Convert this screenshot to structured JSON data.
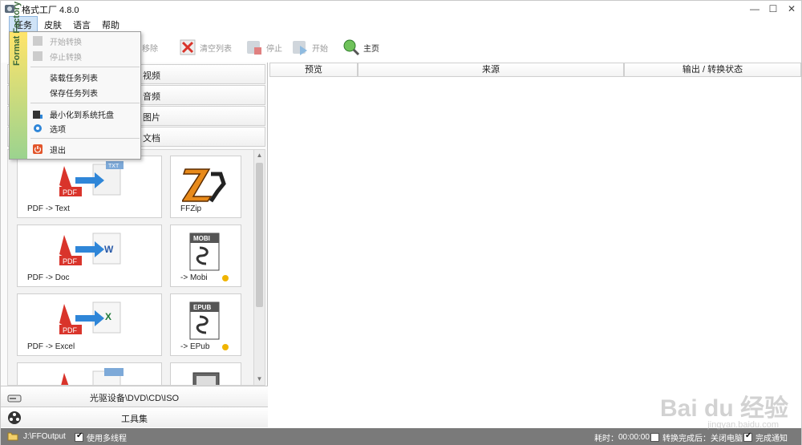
{
  "window": {
    "title": "格式工厂 4.8.0",
    "controls": {
      "minimize": "—",
      "maximize": "☐",
      "close": "✕"
    }
  },
  "menubar": {
    "items": [
      {
        "label": "任务",
        "open": true
      },
      {
        "label": "皮肤"
      },
      {
        "label": "语言"
      },
      {
        "label": "帮助"
      }
    ]
  },
  "toolbar": {
    "remove": "移除",
    "clear": "清空列表",
    "stop": "停止",
    "start": "开始",
    "home": "主页"
  },
  "dropdown": {
    "side_text": "Format Factory",
    "items": [
      {
        "label": "开始转换",
        "enabled": false,
        "icon": "gear-icon"
      },
      {
        "label": "停止转换",
        "enabled": false,
        "icon": "stop-icon"
      },
      {
        "label": "装载任务列表",
        "enabled": true,
        "icon": ""
      },
      {
        "label": "保存任务列表",
        "enabled": true,
        "icon": ""
      },
      {
        "label": "最小化到系统托盘",
        "enabled": true,
        "icon": "tray-icon"
      },
      {
        "label": "选项",
        "enabled": true,
        "icon": "options-icon"
      },
      {
        "label": "退出",
        "enabled": true,
        "icon": "power-icon"
      }
    ]
  },
  "leftpanel": {
    "categories": [
      "视频",
      "音频",
      "图片",
      "文档"
    ],
    "tiles": [
      {
        "label": "PDF -> Text",
        "icon": "pdf-to-text-icon",
        "dot": false
      },
      {
        "label": "FFZip",
        "icon": "ffzip-icon",
        "dot": false
      },
      {
        "label": "PDF -> Doc",
        "icon": "pdf-to-doc-icon",
        "dot": false
      },
      {
        "label": "-> Mobi",
        "icon": "mobi-icon",
        "dot": true
      },
      {
        "label": "PDF -> Excel",
        "icon": "pdf-to-excel-icon",
        "dot": false
      },
      {
        "label": "-> EPub",
        "icon": "epub-icon",
        "dot": true
      }
    ],
    "bottom": {
      "optical": "光驱设备\\DVD\\CD\\ISO",
      "tools": "工具集"
    }
  },
  "rightpanel": {
    "columns": [
      "预览",
      "来源",
      "输出 / 转换状态"
    ]
  },
  "statusbar": {
    "output_path": "J:\\FFOutput",
    "multithread": "使用多线程",
    "multithread_checked": true,
    "elapsed_label": "耗时：",
    "elapsed_value": "00:00:00",
    "after_convert": "转换完成后：关闭电脑",
    "after_convert_checked": false,
    "notify": "完成通知",
    "notify_checked": true
  },
  "watermark": {
    "main": "Bai du 经验",
    "sub": "jingyan.baidu.com"
  },
  "colors": {
    "statusbar": "#7a7a7a",
    "accent_dot": "#f0b400",
    "pdf_red": "#d9342b"
  }
}
